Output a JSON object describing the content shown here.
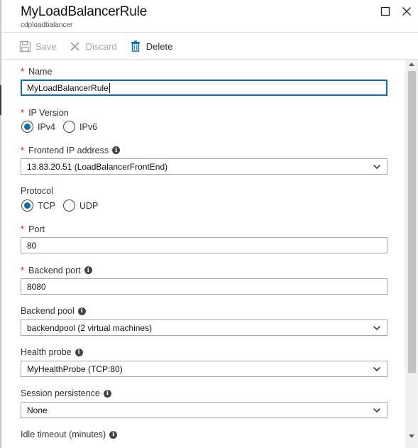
{
  "header": {
    "title": "MyLoadBalancerRule",
    "subtitle": "cdploadbalancer"
  },
  "toolbar": {
    "save_label": "Save",
    "discard_label": "Discard",
    "delete_label": "Delete"
  },
  "form": {
    "name": {
      "label": "Name",
      "required": true,
      "value": "MyLoadBalancerRule"
    },
    "ip_version": {
      "label": "IP Version",
      "required": true,
      "options": [
        "IPv4",
        "IPv6"
      ],
      "selected": "IPv4"
    },
    "frontend_ip": {
      "label": "Frontend IP address",
      "required": true,
      "value": "13.83.20.51 (LoadBalancerFrontEnd)"
    },
    "protocol": {
      "label": "Protocol",
      "required": false,
      "options": [
        "TCP",
        "UDP"
      ],
      "selected": "TCP"
    },
    "port": {
      "label": "Port",
      "required": true,
      "value": "80"
    },
    "backend_port": {
      "label": "Backend port",
      "required": true,
      "value": "8080"
    },
    "backend_pool": {
      "label": "Backend pool",
      "required": false,
      "value": "backendpool (2 virtual machines)"
    },
    "health_probe": {
      "label": "Health probe",
      "required": false,
      "value": "MyHealthProbe (TCP:80)"
    },
    "session_persistence": {
      "label": "Session persistence",
      "required": false,
      "value": "None"
    },
    "idle_timeout": {
      "label": "Idle timeout (minutes)",
      "required": false
    }
  },
  "colors": {
    "accent": "#0a6ea8",
    "required_star": "#e00b1c",
    "disabled_text": "#a6a6a6"
  },
  "icons": {
    "save": "save-icon",
    "discard": "discard-icon",
    "delete": "delete-icon",
    "maximize": "maximize-icon",
    "close": "close-icon",
    "info": "info-icon",
    "chevron": "chevron-down-icon"
  }
}
